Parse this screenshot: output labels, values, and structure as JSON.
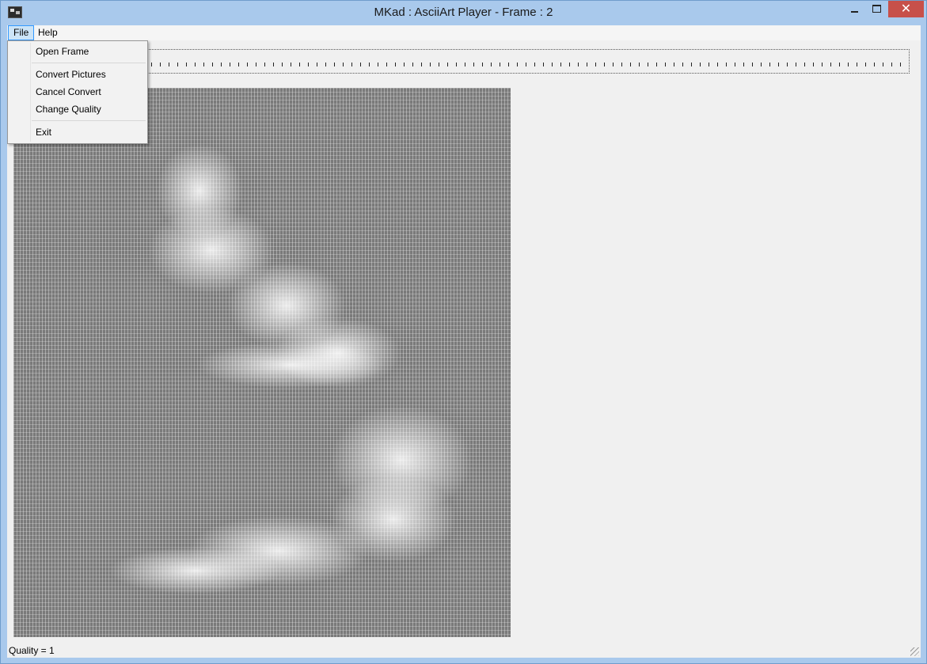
{
  "window": {
    "title": "MKad : AsciiArt Player - Frame : 2",
    "close_symbol": "✕"
  },
  "menubar": {
    "file": "File",
    "help": "Help"
  },
  "file_menu": {
    "items": [
      "Open Frame",
      "Convert Pictures",
      "Cancel Convert",
      "Change Quality",
      "Exit"
    ]
  },
  "status": {
    "text": "Quality = 1"
  },
  "colors": {
    "titlebar": "#a9c9ec",
    "close_button": "#c7504a",
    "art_background": "#7a7a7a"
  }
}
